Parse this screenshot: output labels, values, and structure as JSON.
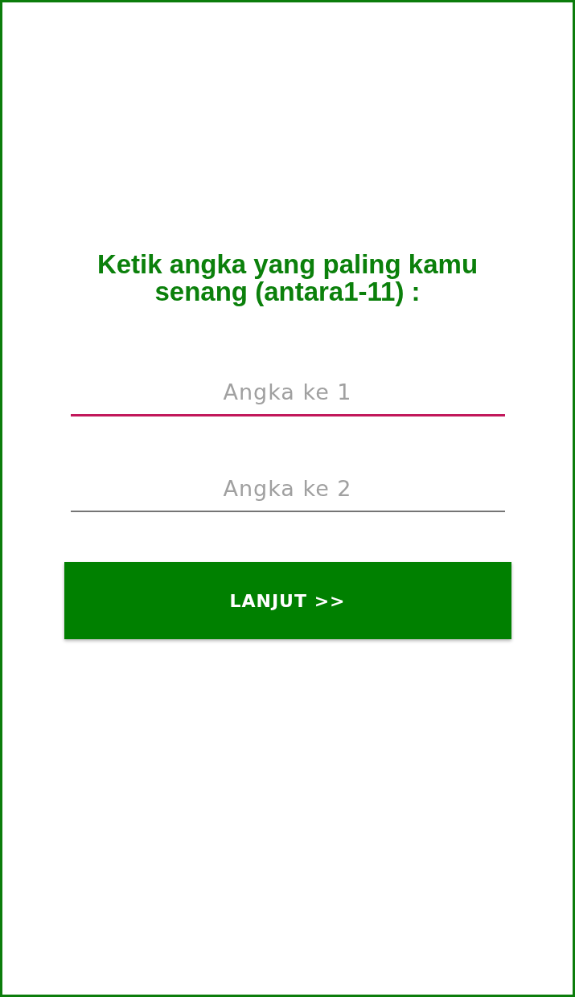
{
  "title": "Ketik angka yang paling kamu senang (antara1-11) :",
  "fields": [
    {
      "placeholder": "Angka ke 1",
      "focused": true
    },
    {
      "placeholder": "Angka ke 2",
      "focused": false
    }
  ],
  "button": {
    "label": "LANJUT >>"
  }
}
